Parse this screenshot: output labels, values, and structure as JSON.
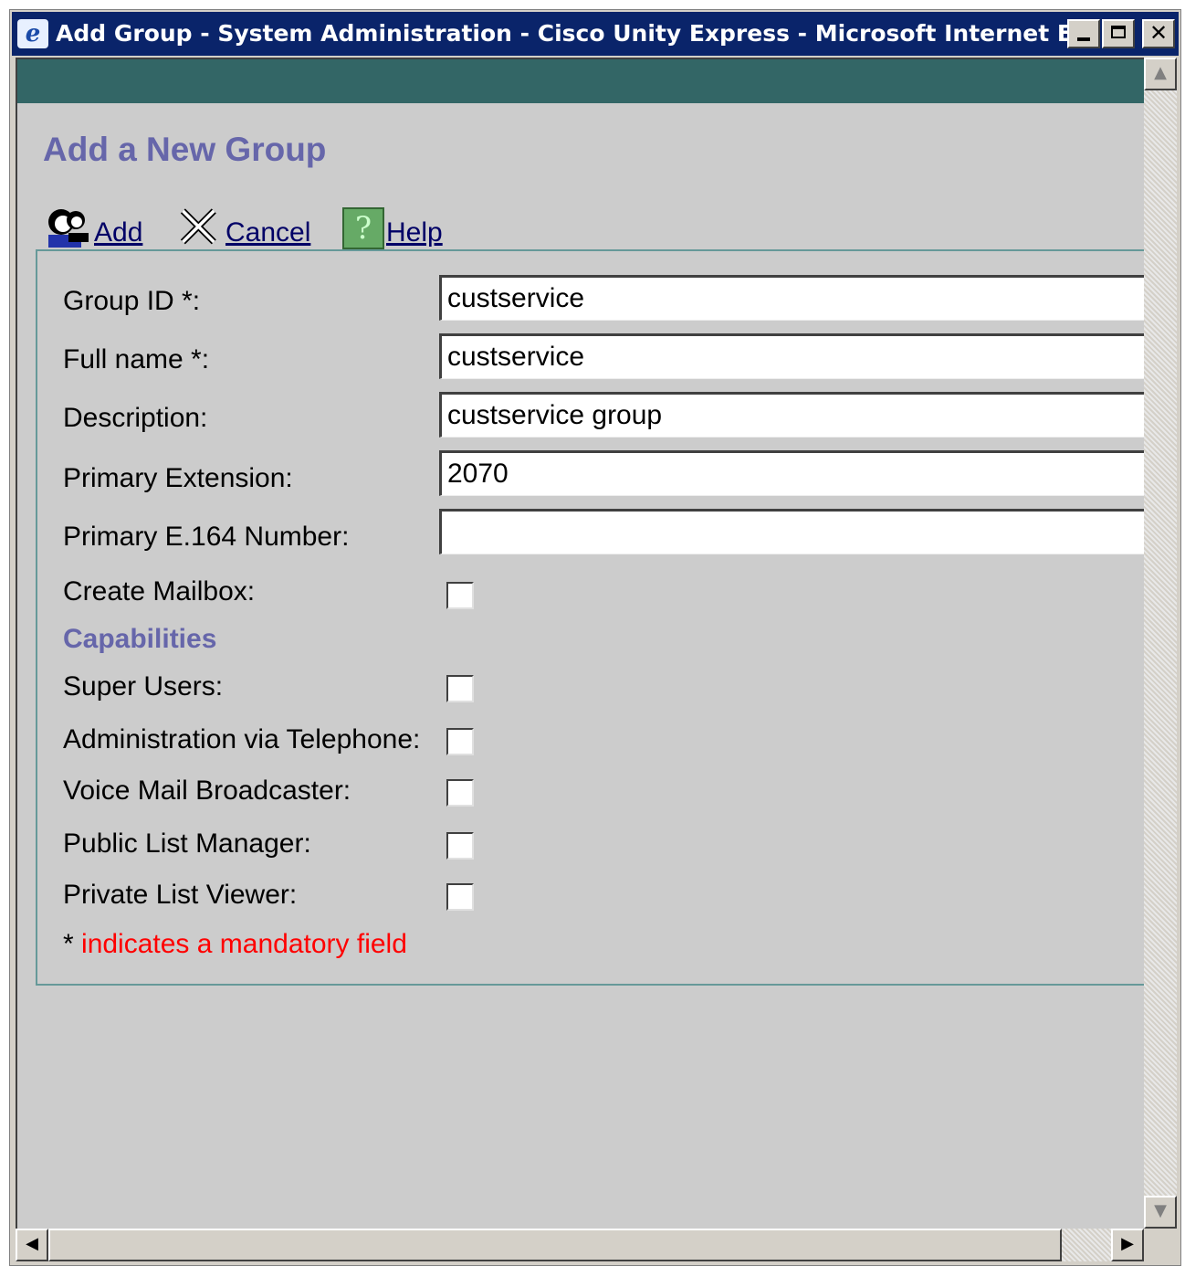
{
  "window": {
    "title": "Add Group - System Administration - Cisco Unity Express - Microsoft Internet Ex..."
  },
  "page": {
    "title": "Add a New Group"
  },
  "toolbar": {
    "add_label": "Add",
    "cancel_label": "Cancel",
    "help_label": "Help",
    "help_glyph": "?"
  },
  "form": {
    "group_id": {
      "label": "Group ID *:",
      "value": "custservice"
    },
    "full_name": {
      "label": "Full name *:",
      "value": "custservice"
    },
    "description": {
      "label": "Description:",
      "value": "custservice group"
    },
    "primary_extension": {
      "label": "Primary Extension:",
      "value": "2070"
    },
    "primary_e164": {
      "label": "Primary E.164 Number:",
      "value": ""
    },
    "create_mailbox": {
      "label": "Create Mailbox:",
      "checked": false
    }
  },
  "capabilities": {
    "heading": "Capabilities",
    "items": [
      {
        "label": "Super Users:",
        "checked": false
      },
      {
        "label": "Administration via Telephone:",
        "checked": false
      },
      {
        "label": "Voice Mail Broadcaster:",
        "checked": false
      },
      {
        "label": "Public List Manager:",
        "checked": false
      },
      {
        "label": "Private List Viewer:",
        "checked": false
      }
    ]
  },
  "footer": {
    "star": "*",
    "mandatory_note": " indicates a mandatory field"
  },
  "colors": {
    "title_bar": "#0a246a",
    "header_band": "#336666",
    "heading": "#6666aa",
    "mandatory": "#ff0000"
  }
}
